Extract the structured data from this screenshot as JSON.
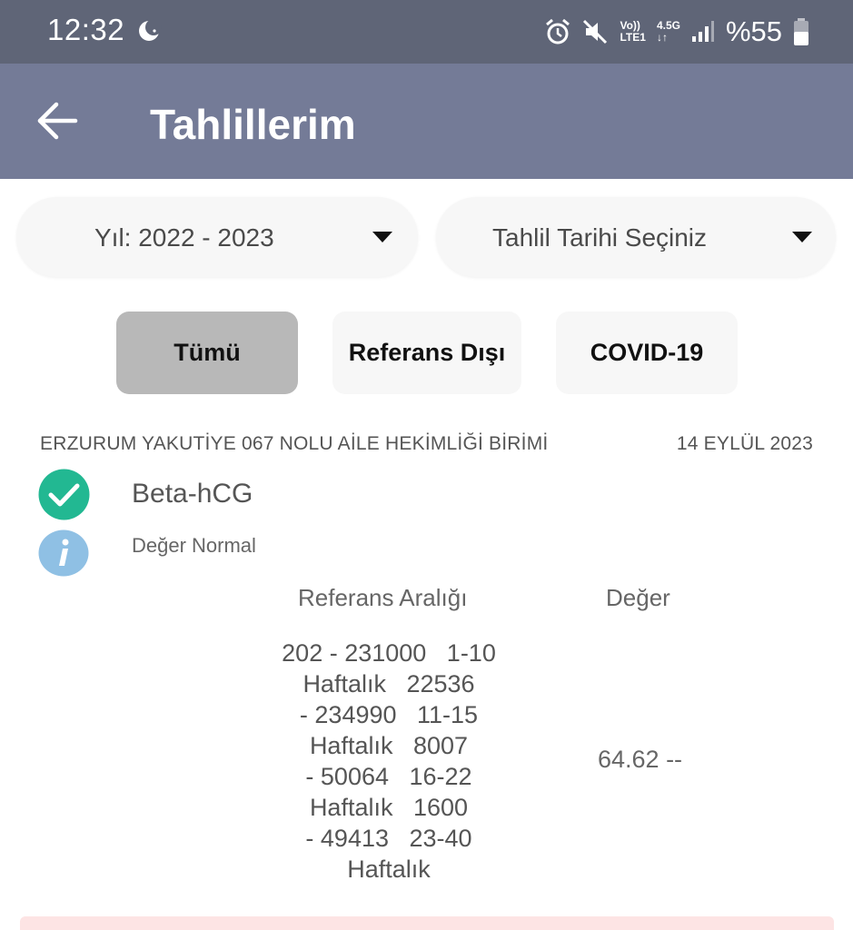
{
  "status_bar": {
    "time": "12:32",
    "network_top": "Vo))",
    "network_bottom": "LTE1",
    "network_gen": "4.5G",
    "battery": "%55",
    "icons": [
      "moon-icon",
      "alarm-icon",
      "mute-icon",
      "signal-icon",
      "battery-icon"
    ]
  },
  "app_bar": {
    "title": "Tahlillerim",
    "back_icon": "arrow-left-icon"
  },
  "filters": {
    "year_select": "Yıl: 2022 - 2023",
    "date_select": "Tahlil Tarihi Seçiniz",
    "buttons": [
      {
        "label": "Tümü",
        "active": true
      },
      {
        "label": "Referans Dışı",
        "active": false
      },
      {
        "label": "COVID-19",
        "active": false
      }
    ]
  },
  "result": {
    "facility": "ERZURUM YAKUTİYE 067 NOLU AİLE HEKİMLİĞİ BİRİMİ",
    "date": "14 EYLÜL 2023",
    "test_name": "Beta-hCG",
    "status": "Değer Normal",
    "ref_header": "Referans Aralığı",
    "value_header": "Değer",
    "ref_lines": [
      "202 - 231000   1-10",
      "Haftalık   22536",
      "- 234990   11-15",
      "Haftalık   8007",
      "- 50064   16-22",
      "Haftalık   1600",
      "- 49413   23-40",
      "Haftalık"
    ],
    "value": "64.62 --"
  },
  "colors": {
    "status_bar": "#5f6577",
    "app_bar": "#747b97",
    "active_filter": "#b8b8b8",
    "check_green": "#22b892",
    "info_blue": "#8fc0e4",
    "next_card": "#fde4e4"
  }
}
